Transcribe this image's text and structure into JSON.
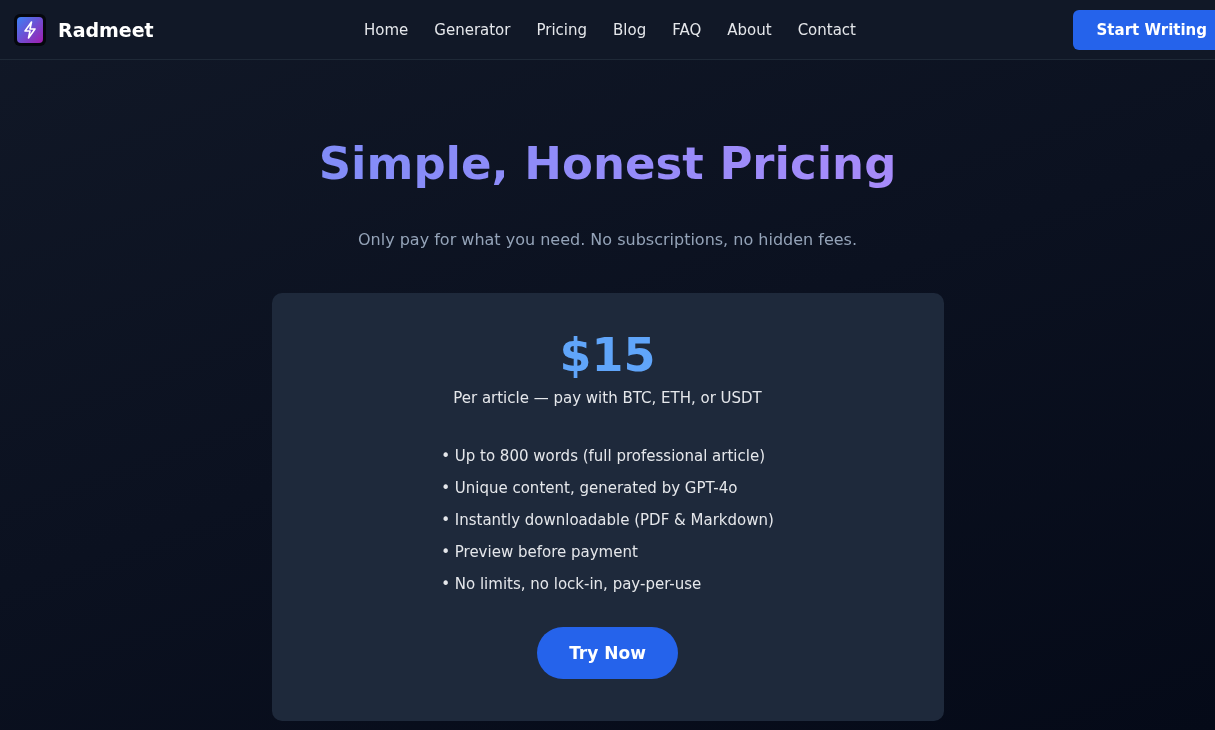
{
  "header": {
    "brand": "Radmeet",
    "nav": [
      {
        "label": "Home"
      },
      {
        "label": "Generator"
      },
      {
        "label": "Pricing"
      },
      {
        "label": "Blog"
      },
      {
        "label": "FAQ"
      },
      {
        "label": "About"
      },
      {
        "label": "Contact"
      }
    ],
    "cta": "Start Writing"
  },
  "hero": {
    "title": "Simple, Honest Pricing",
    "subtitle": "Only pay for what you need. No subscriptions, no hidden fees."
  },
  "card": {
    "price": "$15",
    "price_note": "Per article — pay with BTC, ETH, or USDT",
    "features": [
      "• Up to 800 words (full professional article)",
      "• Unique content, generated by GPT-4o",
      "• Instantly downloadable (PDF & Markdown)",
      "• Preview before payment",
      "• No limits, no lock-in, pay-per-use"
    ],
    "button": "Try Now"
  }
}
